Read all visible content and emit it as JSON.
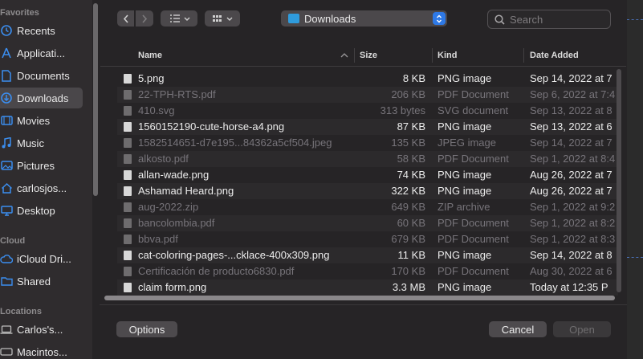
{
  "sidebar": {
    "favorites_title": "Favorites",
    "items": [
      {
        "label": "Recents",
        "icon": "clock-icon"
      },
      {
        "label": "Applicati...",
        "icon": "applications-icon"
      },
      {
        "label": "Documents",
        "icon": "document-icon"
      },
      {
        "label": "Downloads",
        "icon": "download-icon",
        "selected": true
      },
      {
        "label": "Movies",
        "icon": "film-icon"
      },
      {
        "label": "Music",
        "icon": "music-note-icon"
      },
      {
        "label": "Pictures",
        "icon": "picture-icon"
      },
      {
        "label": "carlosjos...",
        "icon": "home-icon"
      },
      {
        "label": "Desktop",
        "icon": "desktop-icon"
      }
    ],
    "cloud_title": "Cloud",
    "cloud_items": [
      {
        "label": "iCloud Dri...",
        "icon": "cloud-icon"
      },
      {
        "label": "Shared",
        "icon": "shared-folder-icon"
      }
    ],
    "locations_title": "Locations",
    "location_items": [
      {
        "label": "Carlos's...",
        "icon": "laptop-icon"
      },
      {
        "label": "Macintos...",
        "icon": "disk-icon"
      }
    ]
  },
  "toolbar": {
    "location": "Downloads",
    "search_placeholder": "Search"
  },
  "columns": {
    "name": "Name",
    "size": "Size",
    "kind": "Kind",
    "date_added": "Date Added"
  },
  "files": [
    {
      "name": "5.png",
      "size": "8 KB",
      "kind": "PNG image",
      "date": "Sep 14, 2022 at 7",
      "enabled": true
    },
    {
      "name": "22-TPH-RTS.pdf",
      "size": "206 KB",
      "kind": "PDF Document",
      "date": "Sep 6, 2022 at 7:4",
      "enabled": false
    },
    {
      "name": "410.svg",
      "size": "313 bytes",
      "kind": "SVG document",
      "date": "Sep 13, 2022 at 8",
      "enabled": false
    },
    {
      "name": "1560152190-cute-horse-a4.png",
      "size": "87 KB",
      "kind": "PNG image",
      "date": "Sep 13, 2022 at 6",
      "enabled": true
    },
    {
      "name": "1582514651-d7e195...84362a5cf504.jpeg",
      "size": "135 KB",
      "kind": "JPEG image",
      "date": "Sep 14, 2022 at 7",
      "enabled": false
    },
    {
      "name": "alkosto.pdf",
      "size": "58 KB",
      "kind": "PDF Document",
      "date": "Sep 1, 2022 at 8:4",
      "enabled": false
    },
    {
      "name": "allan-wade.png",
      "size": "74 KB",
      "kind": "PNG image",
      "date": "Aug 26, 2022 at 7",
      "enabled": true
    },
    {
      "name": "Ashamad Heard.png",
      "size": "322 KB",
      "kind": "PNG image",
      "date": "Aug 26, 2022 at 7",
      "enabled": true
    },
    {
      "name": "aug-2022.zip",
      "size": "649 KB",
      "kind": "ZIP archive",
      "date": "Sep 1, 2022 at 9:2",
      "enabled": false
    },
    {
      "name": "bancolombia.pdf",
      "size": "60 KB",
      "kind": "PDF Document",
      "date": "Sep 1, 2022 at 8:2",
      "enabled": false
    },
    {
      "name": "bbva.pdf",
      "size": "679 KB",
      "kind": "PDF Document",
      "date": "Sep 1, 2022 at 8:3",
      "enabled": false
    },
    {
      "name": "cat-coloring-pages-...cklace-400x309.png",
      "size": "11 KB",
      "kind": "PNG image",
      "date": "Sep 14, 2022 at 8",
      "enabled": true
    },
    {
      "name": "Certificación de producto6830.pdf",
      "size": "170 KB",
      "kind": "PDF Document",
      "date": "Aug 30, 2022 at 6",
      "enabled": false
    },
    {
      "name": "claim form.png",
      "size": "3.3 MB",
      "kind": "PNG image",
      "date": "Today at 12:35 P",
      "enabled": true
    }
  ],
  "footer": {
    "options": "Options",
    "cancel": "Cancel",
    "open": "Open"
  }
}
